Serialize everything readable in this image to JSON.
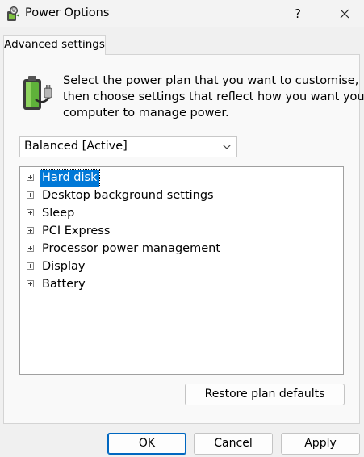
{
  "window": {
    "title": "Power Options",
    "app_icon": "power-options-icon",
    "help_label": "?",
    "close_icon": "close-icon"
  },
  "tab": {
    "label": "Advanced settings"
  },
  "description": {
    "lines": [
      "Select the power plan that you want to customise,",
      "then choose settings that reflect how you want your",
      "computer to manage power."
    ],
    "icon": "battery-plug-icon"
  },
  "plan_select": {
    "value": "Balanced [Active]",
    "icon": "chevron-down-icon"
  },
  "settings_tree": {
    "items": [
      {
        "label": "Hard disk",
        "expander": "+",
        "selected": true
      },
      {
        "label": "Desktop background settings",
        "expander": "+",
        "selected": false
      },
      {
        "label": "Sleep",
        "expander": "+",
        "selected": false
      },
      {
        "label": "PCI Express",
        "expander": "+",
        "selected": false
      },
      {
        "label": "Processor power management",
        "expander": "+",
        "selected": false
      },
      {
        "label": "Display",
        "expander": "+",
        "selected": false
      },
      {
        "label": "Battery",
        "expander": "+",
        "selected": false
      }
    ]
  },
  "buttons": {
    "restore": "Restore plan defaults",
    "ok": "OK",
    "cancel": "Cancel",
    "apply": "Apply"
  },
  "colors": {
    "selection": "#0078d7",
    "default_button_border": "#0067c0"
  }
}
